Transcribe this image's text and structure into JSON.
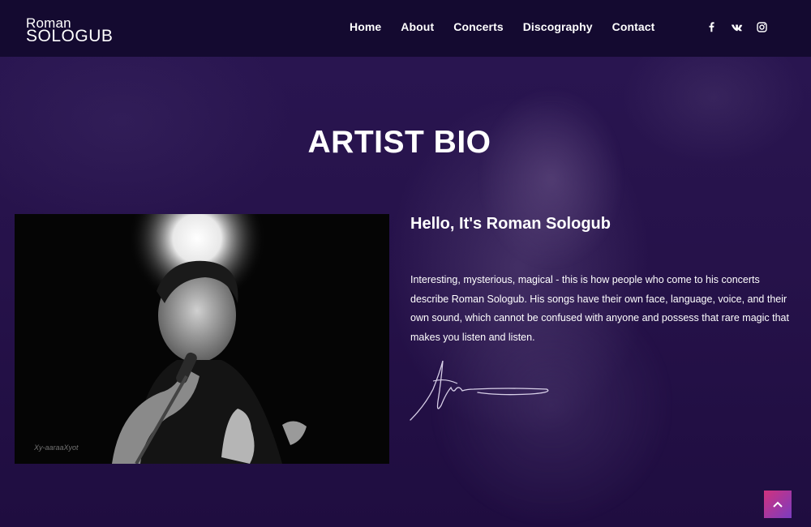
{
  "header": {
    "logo": {
      "line1": "Roman",
      "line2": "SOLOGUB"
    },
    "nav": [
      {
        "label": "Home"
      },
      {
        "label": "About"
      },
      {
        "label": "Concerts"
      },
      {
        "label": "Discography"
      },
      {
        "label": "Contact"
      }
    ],
    "social": [
      {
        "icon": "facebook-icon",
        "glyph": "f"
      },
      {
        "icon": "vk-icon",
        "glyph": "vk"
      },
      {
        "icon": "instagram-icon",
        "glyph": ""
      }
    ]
  },
  "main": {
    "section_title": "ARTIST BIO",
    "photo_watermark": "Xy-aaraaXyot",
    "bio_heading": "Hello, It's Roman Sologub",
    "bio_text": "Interesting, mysterious, magical - this is how people who come to his concerts describe Roman Sologub. His songs have their own face, language, voice, and their own sound, which cannot be confused with anyone and possess that rare magic that makes you listen and listen."
  },
  "scroll_top": {
    "icon": "chevron-up-icon"
  },
  "colors": {
    "background": "#231144",
    "header": "#140a30",
    "accent_start": "#d1327d",
    "accent_end": "#7b3cc0"
  }
}
